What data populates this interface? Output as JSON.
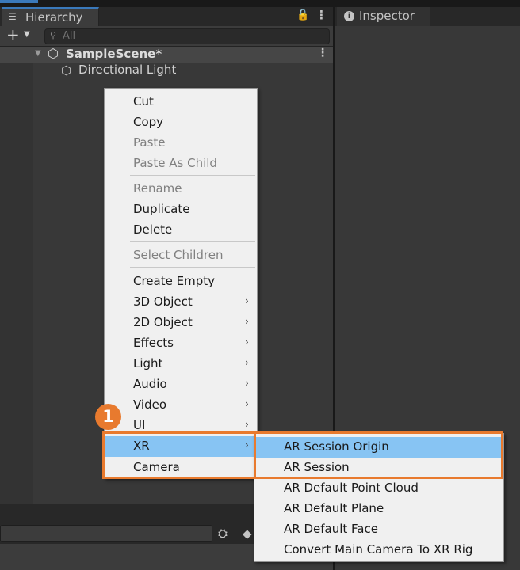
{
  "hierarchy": {
    "tab_title": "Hierarchy",
    "tab_icon": "list-icon",
    "search_placeholder": "All",
    "scene_name": "SampleScene*",
    "objects": [
      "Directional Light"
    ]
  },
  "inspector": {
    "tab_title": "Inspector",
    "tab_icon": "info-icon"
  },
  "context_menu": {
    "items": [
      {
        "label": "Cut",
        "enabled": true
      },
      {
        "label": "Copy",
        "enabled": true
      },
      {
        "label": "Paste",
        "enabled": false
      },
      {
        "label": "Paste As Child",
        "enabled": false
      },
      {
        "label": "Rename",
        "enabled": false
      },
      {
        "label": "Duplicate",
        "enabled": true
      },
      {
        "label": "Delete",
        "enabled": true
      },
      {
        "label": "Select Children",
        "enabled": false
      },
      {
        "label": "Create Empty",
        "enabled": true
      },
      {
        "label": "3D Object",
        "enabled": true,
        "submenu": true
      },
      {
        "label": "2D Object",
        "enabled": true,
        "submenu": true
      },
      {
        "label": "Effects",
        "enabled": true,
        "submenu": true
      },
      {
        "label": "Light",
        "enabled": true,
        "submenu": true
      },
      {
        "label": "Audio",
        "enabled": true,
        "submenu": true
      },
      {
        "label": "Video",
        "enabled": true,
        "submenu": true
      },
      {
        "label": "UI",
        "enabled": true,
        "submenu": true
      },
      {
        "label": "XR",
        "enabled": true,
        "submenu": true,
        "selected": true
      },
      {
        "label": "Camera",
        "enabled": true
      }
    ]
  },
  "xr_submenu": {
    "items": [
      {
        "label": "AR Session Origin",
        "selected": true
      },
      {
        "label": "AR Session"
      },
      {
        "label": "AR Default Point Cloud"
      },
      {
        "label": "AR Default Plane"
      },
      {
        "label": "AR Default Face"
      },
      {
        "label": "Convert Main Camera To XR Rig"
      }
    ]
  },
  "annotation": {
    "step_number": "1",
    "color": "#e87a2e"
  },
  "colors": {
    "menu_bg": "#f0f0f0",
    "selection": "#87c4f3",
    "panel_bg": "#383838",
    "accent_blue": "#3a79bb"
  }
}
